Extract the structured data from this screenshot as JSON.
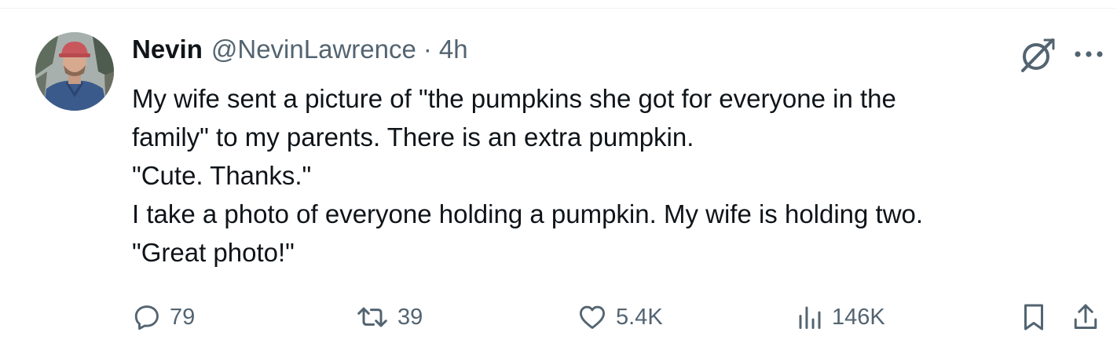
{
  "tweet": {
    "author": {
      "display_name": "Nevin",
      "handle": "@NevinLawrence",
      "avatar_icon": "profile-photo"
    },
    "separator": "·",
    "time": "4h",
    "body_lines": [
      "My wife sent a picture of \"the pumpkins she got for everyone in the",
      "family\" to my parents. There is an extra pumpkin.",
      "\"Cute. Thanks.\"",
      "I take a photo of everyone holding a pumpkin. My wife is holding two.",
      "\"Great photo!\""
    ],
    "header_icons": [
      "grok-icon",
      "more-icon"
    ],
    "actions": {
      "replies": "79",
      "reposts": "39",
      "likes": "5.4K",
      "views": "146K"
    },
    "colors": {
      "text": "#0f1419",
      "secondary": "#536471",
      "border": "#eff3f4"
    }
  }
}
